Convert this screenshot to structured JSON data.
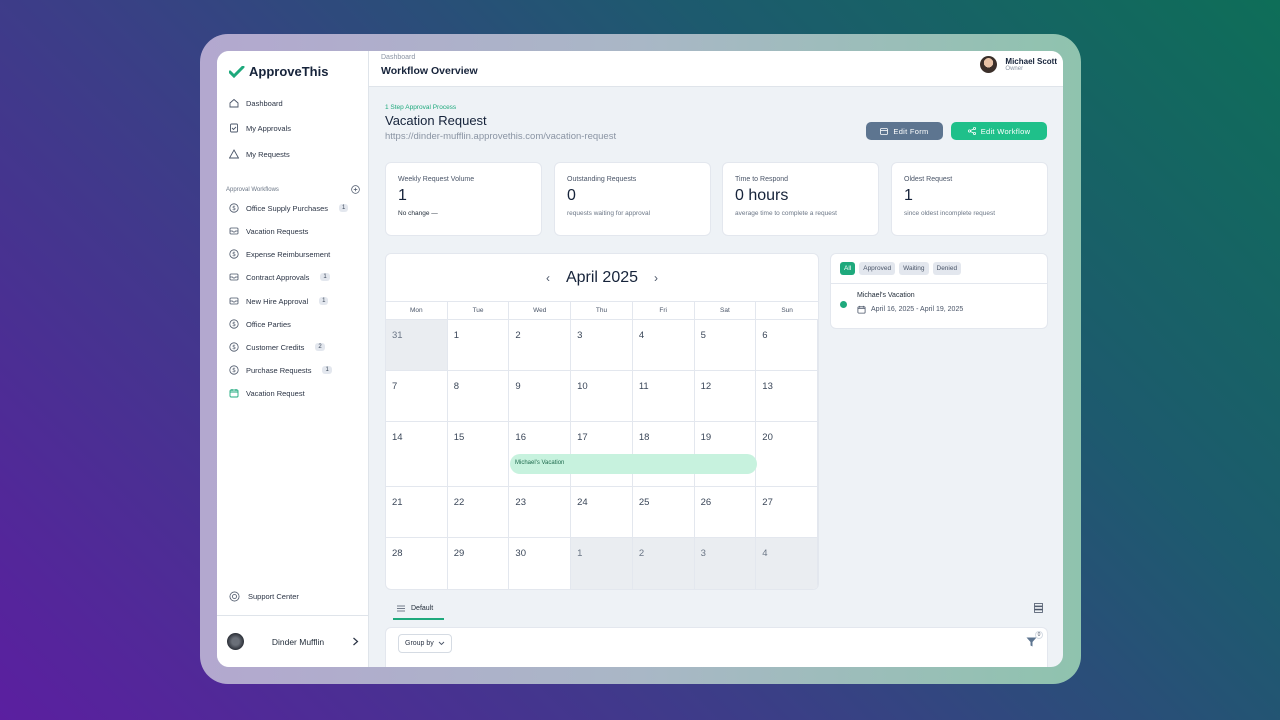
{
  "app": {
    "logo": "ApproveThis",
    "accent": "#1ea97c"
  },
  "nav": {
    "items": [
      {
        "label": "Dashboard",
        "icon": "home-icon"
      },
      {
        "label": "My Approvals",
        "icon": "checklist-icon"
      },
      {
        "label": "My Requests",
        "icon": "warning-triangle-icon"
      }
    ],
    "section_title": "Approval Workflows",
    "workflows": [
      {
        "label": "Office Supply Purchases",
        "badge": "1"
      },
      {
        "label": "Vacation Requests",
        "badge": ""
      },
      {
        "label": "Expense Reimbursement",
        "badge": ""
      },
      {
        "label": "Contract Approvals",
        "badge": "1"
      },
      {
        "label": "New Hire Approval",
        "badge": "1"
      },
      {
        "label": "Office Parties",
        "badge": ""
      },
      {
        "label": "Customer Credits",
        "badge": "2"
      },
      {
        "label": "Purchase Requests",
        "badge": "1"
      },
      {
        "label": "Vacation Request",
        "badge": ""
      }
    ],
    "support": "Support Center",
    "org": "Dinder Mufflin"
  },
  "header": {
    "breadcrumb": "Dashboard",
    "title": "Workflow Overview",
    "user_name": "Michael Scott",
    "user_role": "Owner"
  },
  "workflow": {
    "steps": "1 Step Approval Process",
    "title": "Vacation Request",
    "url": "https://dinder-mufflin.approvethis.com/vacation-request",
    "edit_form": "Edit Form",
    "edit_workflow": "Edit Workflow"
  },
  "stats": [
    {
      "label": "Weekly Request Volume",
      "value": "1",
      "sub": "No change —"
    },
    {
      "label": "Outstanding Requests",
      "value": "0",
      "sub": "requests waiting for approval"
    },
    {
      "label": "Time to Respond",
      "value": "0 hours",
      "sub": "average time to complete a request"
    },
    {
      "label": "Oldest Request",
      "value": "1",
      "sub": "since oldest incomplete request"
    }
  ],
  "calendar": {
    "month": "April 2025",
    "dows": [
      "Mon",
      "Tue",
      "Wed",
      "Thu",
      "Fri",
      "Sat",
      "Sun"
    ],
    "weeks": [
      [
        "31",
        "1",
        "2",
        "3",
        "4",
        "5",
        "6"
      ],
      [
        "7",
        "8",
        "9",
        "10",
        "11",
        "12",
        "13"
      ],
      [
        "14",
        "15",
        "16",
        "17",
        "18",
        "19",
        "20"
      ],
      [
        "21",
        "22",
        "23",
        "24",
        "25",
        "26",
        "27"
      ],
      [
        "28",
        "29",
        "30",
        "1",
        "2",
        "3",
        "4"
      ]
    ],
    "event": "Michael's Vacation"
  },
  "requests": {
    "filters": [
      "All",
      "Approved",
      "Waiting",
      "Denied"
    ],
    "item_name": "Michael's Vacation",
    "item_dates": "April 16, 2025 - April 19, 2025"
  },
  "views": {
    "tab": "Default",
    "group_by": "Group by",
    "filter_count": "0"
  }
}
